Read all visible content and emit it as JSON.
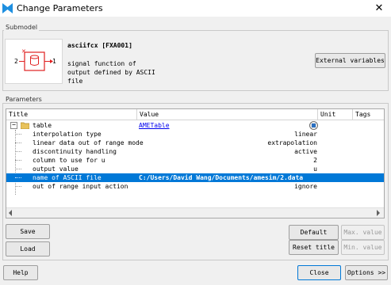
{
  "window": {
    "title": "Change Parameters",
    "close_glyph": "✕"
  },
  "submodel": {
    "group_label": "Submodel",
    "name": "asciifcx [FXA001]",
    "description": [
      "signal function of",
      "output defined by ASCII",
      "file"
    ],
    "port_left": "2",
    "port_right": "1",
    "external_variables_label": "External variables"
  },
  "parameters": {
    "group_label": "Parameters",
    "columns": [
      "Title",
      "Value",
      "Unit",
      "Tags"
    ],
    "root": {
      "title": "table",
      "value": "AMETable",
      "expand_glyph": "−"
    },
    "rows": [
      {
        "title": "interpolation type",
        "value": "linear"
      },
      {
        "title": "linear data out of range mode",
        "value": "extrapolation"
      },
      {
        "title": "discontinuity handling",
        "value": "active"
      },
      {
        "title": "column to use for u",
        "value": "2"
      },
      {
        "title": "output value",
        "value": "u"
      },
      {
        "title": "name of ASCII file",
        "value": "C:/Users/David Wang/Documents/amesim/2.data",
        "selected": true
      },
      {
        "title": "out of range input action",
        "value": "ignore"
      }
    ]
  },
  "buttons": {
    "save": "Save",
    "load": "Load",
    "default_value": "Default value",
    "max_value": "Max. value",
    "reset_title": "Reset title",
    "min_value": "Min. value",
    "help": "Help",
    "close": "Close",
    "options": "Options >>"
  },
  "colors": {
    "selection": "#0078d7",
    "link": "#0000ee",
    "app_icon": "#1e8fe0",
    "block_red": "#e02020"
  }
}
